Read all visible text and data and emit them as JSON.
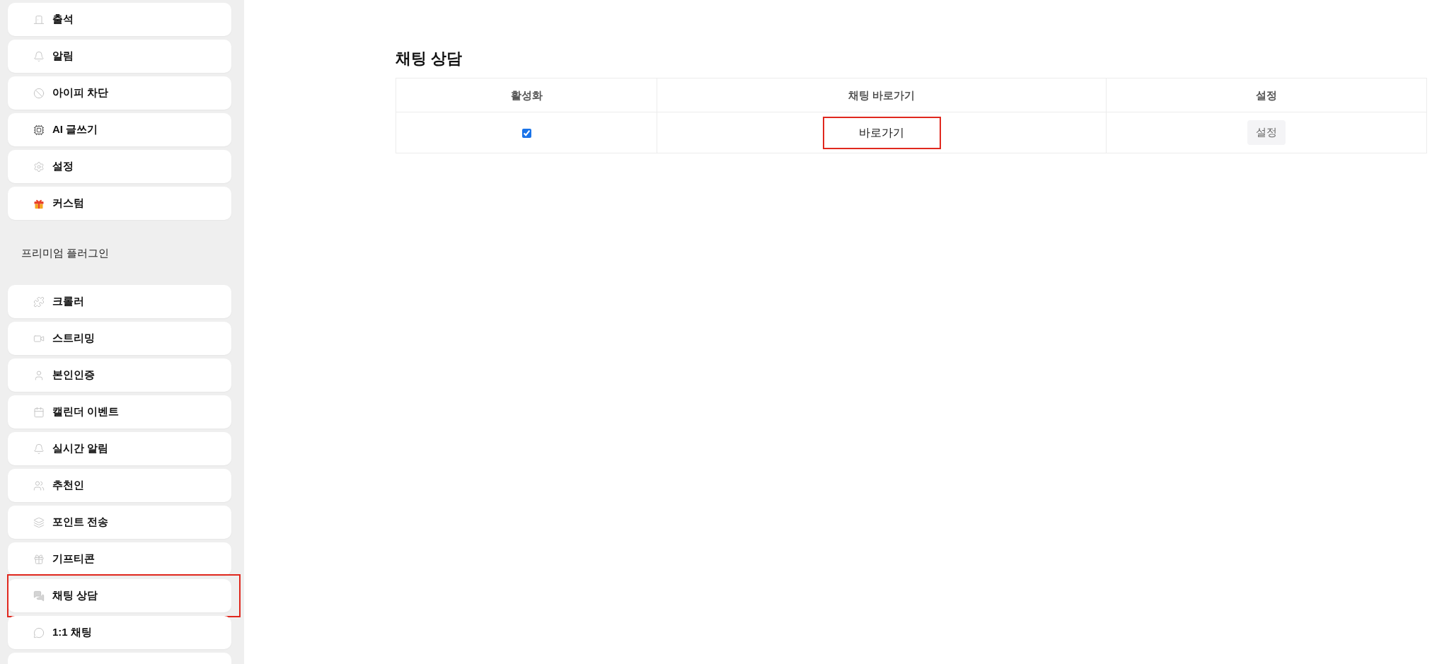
{
  "sidebar": {
    "groups": [
      {
        "items": [
          {
            "label": "출석",
            "highlighted": false
          },
          {
            "label": "알림",
            "highlighted": false
          },
          {
            "label": "아이피 차단",
            "highlighted": false
          },
          {
            "label": "AI 글쓰기",
            "highlighted": false
          },
          {
            "label": "설정",
            "highlighted": false
          },
          {
            "label": "커스텀",
            "highlighted": false
          }
        ]
      },
      {
        "heading": "프리미엄 플러그인",
        "items": [
          {
            "label": "크롤러",
            "highlighted": false
          },
          {
            "label": "스트리밍",
            "highlighted": false
          },
          {
            "label": "본인인증",
            "highlighted": false
          },
          {
            "label": "캘린더 이벤트",
            "highlighted": false
          },
          {
            "label": "실시간 알림",
            "highlighted": false
          },
          {
            "label": "추천인",
            "highlighted": false
          },
          {
            "label": "포인트 전송",
            "highlighted": false
          },
          {
            "label": "기프티콘",
            "highlighted": false
          },
          {
            "label": "채팅 상담",
            "highlighted": true
          },
          {
            "label": "1:1 채팅",
            "highlighted": false
          }
        ]
      }
    ]
  },
  "main": {
    "title": "채팅 상담",
    "table": {
      "columns": [
        "활성화",
        "채팅 바로가기",
        "설정"
      ],
      "rows": [
        {
          "cells": [
            {
              "kind": "checkbox",
              "checked": true
            },
            {
              "kind": "link",
              "label": "바로가기",
              "highlighted": true
            },
            {
              "kind": "button",
              "label": "설정"
            }
          ]
        }
      ]
    }
  }
}
